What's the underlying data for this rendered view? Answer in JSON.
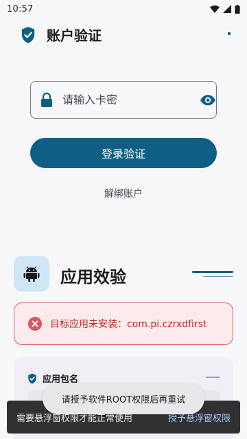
{
  "status_bar": {
    "time": "10:57",
    "icons": [
      "wifi-icon",
      "signal-icon",
      "battery-icon"
    ]
  },
  "account": {
    "title": "账户验证",
    "title_icon": "shield-check-icon",
    "card_input": {
      "placeholder": "请输入卡密",
      "value": "",
      "leading_icon": "lock-icon",
      "trailing_icon": "eye-icon"
    },
    "login_button": "登录验证",
    "unbind_link": "解绑账户"
  },
  "app_check": {
    "title": "应用效验",
    "title_icon": "android-icon",
    "error_icon": "error-circle-icon",
    "error_text": "目标应用未安装：com.pi.czrxdfirst",
    "package_label": "应用包名",
    "package_icon": "shield-check-icon"
  },
  "toast": {
    "text": "请授予软件ROOT权限后再重试"
  },
  "snackbar": {
    "message": "需要悬浮窗权限才能正常使用",
    "action": "授予悬浮窗权限"
  },
  "colors": {
    "primary": "#0F5F84",
    "error": "#B3261E",
    "error_bg": "#FCEBEC",
    "tile_bg": "#CFE6F7"
  }
}
